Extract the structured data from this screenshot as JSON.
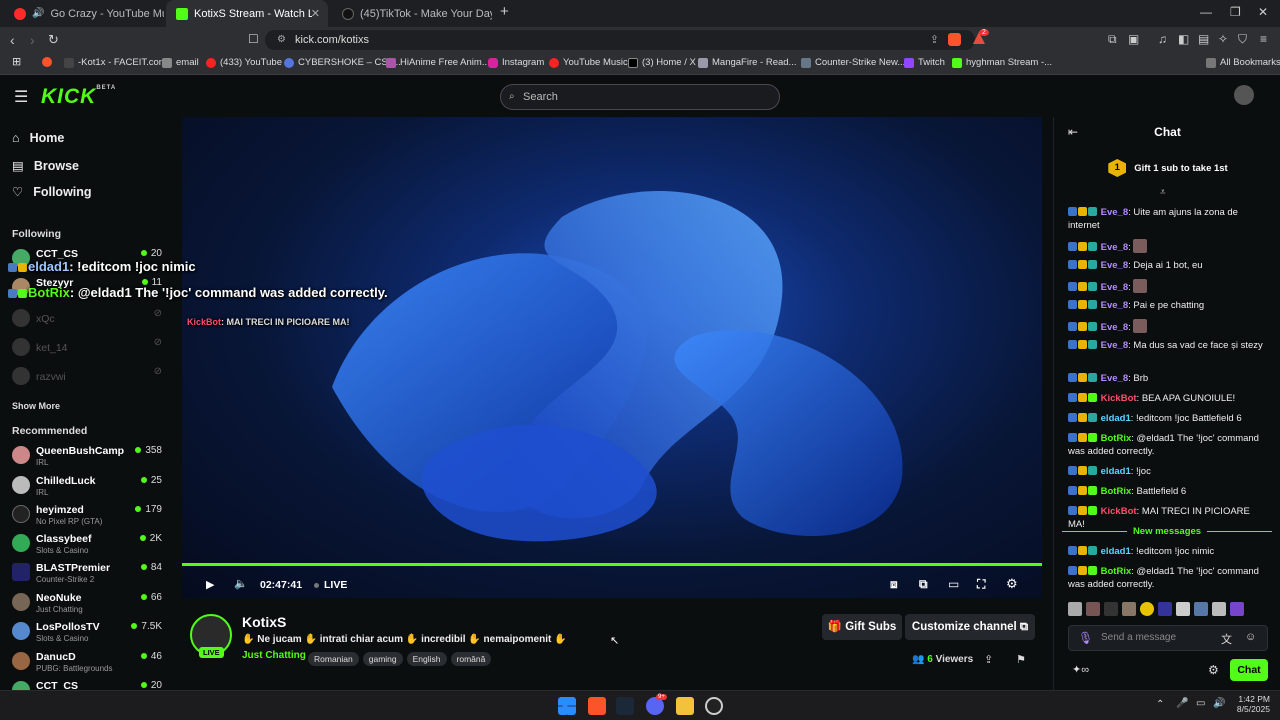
{
  "browser": {
    "tabs": [
      {
        "title": "Go Crazy - YouTube Music",
        "active": false
      },
      {
        "title": "KotixS Stream - Watch Live on Kick",
        "active": true
      },
      {
        "title": "(45)TikTok - Make Your Day",
        "active": false
      }
    ],
    "url": "kick.com/kotixs",
    "bookmarks": [
      "-Kot1x - FACEIT.com",
      "email",
      "(433) YouTube",
      "CYBERSHOKE – CS2...",
      "HiAnime Free Anim...",
      "Instagram",
      "YouTube Music",
      "(3) Home / X",
      "MangaFire - Read...",
      "Counter-Strike New...",
      "Twitch",
      "hyghman Stream -...",
      "All Bookmarks"
    ],
    "brave_badge": "2"
  },
  "header": {
    "logo": "KICK",
    "beta": "BETA",
    "search_placeholder": "Search"
  },
  "sidebar": {
    "nav": [
      {
        "label": "Home",
        "icon": "home-icon"
      },
      {
        "label": "Browse",
        "icon": "browse-icon"
      },
      {
        "label": "Following",
        "icon": "heart-icon"
      }
    ],
    "following_title": "Following",
    "following": [
      {
        "name": "CCT_CS",
        "viewers": "20"
      },
      {
        "name": "Stezyyr",
        "viewers": "11"
      },
      {
        "name": "xQc",
        "viewers": ""
      },
      {
        "name": "ket_14",
        "viewers": ""
      },
      {
        "name": "razvwi",
        "viewers": ""
      }
    ],
    "show_more": "Show More",
    "recommended_title": "Recommended",
    "recommended": [
      {
        "name": "QueenBushCamp",
        "category": "IRL",
        "viewers": "358"
      },
      {
        "name": "ChilledLuck",
        "category": "IRL",
        "viewers": "25"
      },
      {
        "name": "heyimzed",
        "category": "No Pixel RP (GTA)",
        "viewers": "179"
      },
      {
        "name": "Classybeef",
        "category": "Slots & Casino",
        "viewers": "2K"
      },
      {
        "name": "BLASTPremier",
        "category": "Counter-Strike 2",
        "viewers": "84"
      },
      {
        "name": "NeoNuke",
        "category": "Just Chatting",
        "viewers": "66"
      },
      {
        "name": "LosPollosTV",
        "category": "Slots & Casino",
        "viewers": "7.5K"
      },
      {
        "name": "DanucD",
        "category": "PUBG: Battlegrounds",
        "viewers": "46"
      },
      {
        "name": "CCT_CS",
        "category": "",
        "viewers": "20"
      }
    ]
  },
  "video": {
    "overlay_lines": [
      {
        "user": "eldad1",
        "text": ": !editcom !joc nimic"
      },
      {
        "user": "BotRix",
        "text": ": @eldad1 The '!joc' command was added correctly."
      },
      {
        "user": "KickBot",
        "text": ": MAI TRECI IN PICIOARE MA!"
      }
    ],
    "time": "02:47:41",
    "live": "LIVE",
    "progress_fraction": 1.0
  },
  "channel": {
    "name": "KotixS",
    "live_badge": "LIVE",
    "title": "✋ Ne jucam ✋ intrati chiar acum ✋ incredibil ✋ nemaipomenit ✋",
    "category": "Just Chatting",
    "tags": [
      "Romanian",
      "gaming",
      "English",
      "română"
    ],
    "gift_subs": "Gift Subs",
    "customize": "Customize channel",
    "viewers_count": "6",
    "viewers_label": "Viewers"
  },
  "chat": {
    "title": "Chat",
    "gift_banner": "Gift 1 sub to take 1st",
    "gift_rank": "1",
    "messages": [
      {
        "user": "Eve_8",
        "cls": "u1",
        "text": "Uite am ajuns la zona de internet"
      },
      {
        "user": "Eve_8",
        "cls": "u1",
        "text": ""
      },
      {
        "user": "Eve_8",
        "cls": "u1",
        "text": "Deja ai 1 bot, eu"
      },
      {
        "user": "Eve_8",
        "cls": "u1",
        "text": ""
      },
      {
        "user": "Eve_8",
        "cls": "u1",
        "text": "Pai e pe chatting"
      },
      {
        "user": "Eve_8",
        "cls": "u1",
        "text": ""
      },
      {
        "user": "Eve_8",
        "cls": "u1",
        "text": "Ma dus sa vad ce face și stezy"
      },
      {
        "user": "Eve_8",
        "cls": "u1",
        "text": "Brb"
      },
      {
        "user": "KickBot",
        "cls": "u2",
        "text": "BEA APA GUNOIULE!"
      },
      {
        "user": "eldad1",
        "cls": "u3",
        "text": "!editcom !joc Battlefield 6"
      },
      {
        "user": "BotRix",
        "cls": "u4",
        "text": "@eldad1 The '!joc' command was added correctly."
      },
      {
        "user": "eldad1",
        "cls": "u3",
        "text": "!joc"
      },
      {
        "user": "BotRix",
        "cls": "u4",
        "text": "Battlefield 6"
      },
      {
        "user": "KickBot",
        "cls": "u2",
        "text": "MAI TRECI IN PICIOARE MA!"
      }
    ],
    "new_messages": "New messages",
    "new": [
      {
        "user": "eldad1",
        "cls": "u3",
        "text": "!editcom !joc nimic"
      },
      {
        "user": "BotRix",
        "cls": "u4",
        "text": "@eldad1 The '!joc' command was added correctly."
      }
    ],
    "input_placeholder": "Send a message",
    "send_label": "Chat"
  },
  "taskbar": {
    "time": "1:42 PM",
    "date": "8/5/2025",
    "discord_badge": "9+"
  },
  "colors": {
    "accent": "#53fc18",
    "bg": "#0b0e0f",
    "panel": "#24272c"
  }
}
